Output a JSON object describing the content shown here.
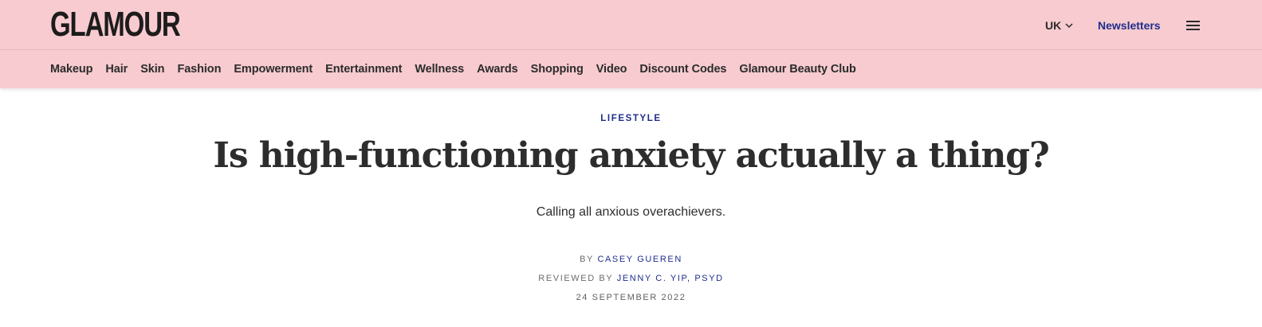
{
  "brand": {
    "logo_text": "GLAMOUR"
  },
  "header": {
    "edition": "UK",
    "newsletters_label": "Newsletters",
    "menu_icon": "hamburger-menu-icon",
    "edition_icon": "chevron-down-icon"
  },
  "nav": {
    "items": [
      {
        "label": "Makeup"
      },
      {
        "label": "Hair"
      },
      {
        "label": "Skin"
      },
      {
        "label": "Fashion"
      },
      {
        "label": "Empowerment"
      },
      {
        "label": "Entertainment"
      },
      {
        "label": "Wellness"
      },
      {
        "label": "Awards"
      },
      {
        "label": "Shopping"
      },
      {
        "label": "Video"
      },
      {
        "label": "Discount Codes"
      },
      {
        "label": "Glamour Beauty Club"
      }
    ]
  },
  "article": {
    "rubric": "LIFESTYLE",
    "headline": "Is high-functioning anxiety actually a thing?",
    "dek": "Calling all anxious overachievers.",
    "byline": {
      "by_prefix": "BY",
      "author": "CASEY GUEREN",
      "reviewed_prefix": "REVIEWED BY",
      "reviewer": "JENNY C. YIP, PSYD"
    },
    "date": "24 SEPTEMBER 2022"
  },
  "colors": {
    "header_background": "#f7cbcf",
    "accent_link": "#1f2d8c",
    "text_dark": "#2d2d2d",
    "text_muted": "#6b6b6b"
  }
}
